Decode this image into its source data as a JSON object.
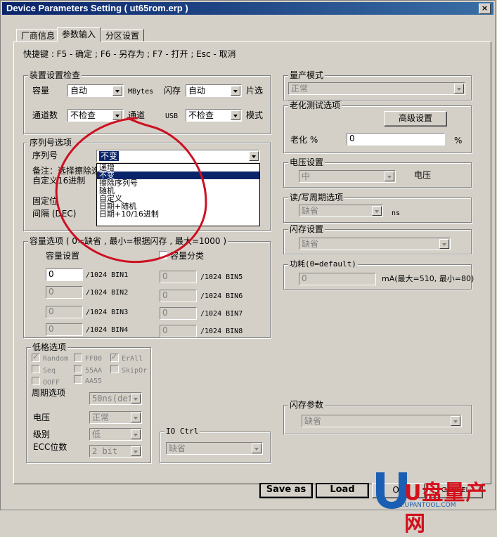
{
  "window": {
    "title": "Device Parameters Setting ( ut65rom.erp )",
    "close": "×"
  },
  "tabs": [
    "厂商信息",
    "参数输入",
    "分区设置"
  ],
  "shortcuts": "快捷键 : F5 - 确定 ; F6 - 另存为 ; F7 - 打开 ; Esc - 取消",
  "device_check": {
    "title": "装置设置检查",
    "capacity_label": "容量",
    "capacity_value": "自动",
    "capacity_unit": "MBytes",
    "flash_label": "闪存",
    "flash_value": "自动",
    "flash_unit": "片选",
    "channels_label": "通道数",
    "channels_value": "不检查",
    "channels_unit": "通道",
    "usb_label": "USB",
    "usb_value": "不检查",
    "usb_unit": "模式"
  },
  "serial": {
    "title": "序列号选项",
    "serial_label": "序列号",
    "serial_value": "不变",
    "note_label": "备注：选择擦除选",
    "custom_label": "自定义16进制",
    "fixed_label": "固定位",
    "interval_label": "间隔 (DEC)",
    "dropdown_items": [
      "递增",
      "不变",
      "擦除序列号",
      "随机",
      "自定义",
      "日期+随机",
      "日期+10/16进制"
    ],
    "dropdown_selected": 1
  },
  "capacity": {
    "title": "容量选项 ( 0=缺省 , 最小=根据闪存 , 最大=1000 )",
    "setting_label": "容量设置",
    "classify_label": "容量分类",
    "unit": "/1024",
    "bins_left": [
      {
        "value": "0",
        "name": "BIN1"
      },
      {
        "value": "0",
        "name": "BIN2"
      },
      {
        "value": "0",
        "name": "BIN3"
      },
      {
        "value": "0",
        "name": "BIN4"
      }
    ],
    "bins_right": [
      {
        "value": "0",
        "name": "BIN5"
      },
      {
        "value": "0",
        "name": "BIN6"
      },
      {
        "value": "0",
        "name": "BIN7"
      },
      {
        "value": "0",
        "name": "BIN8"
      }
    ]
  },
  "lowformat": {
    "title": "低格选项",
    "random": "Random",
    "ff00": "FF00",
    "erall": "ErAll",
    "seq": "Seq",
    "55aa": "55AA",
    "skip": "SkipOr",
    "ooff": "OOFF",
    "aa55": "AA55",
    "cycle_label": "周期选项",
    "cycle_value": "50ns(defa",
    "voltage_label": "电压",
    "voltage_value": "正常",
    "level_label": "级别",
    "level_value": "低",
    "ecc_label": "ECC位数",
    "ecc_value": "2 bit"
  },
  "io": {
    "title": "IO Ctrl",
    "value": "缺省"
  },
  "mass": {
    "title": "量产模式",
    "value": "正常"
  },
  "aging": {
    "title": "老化测试选项",
    "advanced": "高级设置",
    "label": "老化 %",
    "value": "0",
    "unit": "%"
  },
  "voltage": {
    "title": "电压设置",
    "value": "中",
    "unit": "电压"
  },
  "rw": {
    "title": "读/写周期选项",
    "value": "缺省",
    "unit": "ns"
  },
  "flash_set": {
    "title": "闪存设置",
    "value": "缺省"
  },
  "power": {
    "title": "功耗(0=default)",
    "value": "0",
    "unit": "mA(最大=510, 最小=80)"
  },
  "flash_param": {
    "title": "闪存参数",
    "value": "缺省"
  },
  "buttons": {
    "save_as": "Save as",
    "load": "Load",
    "ok": "OK",
    "cancel": "CANCEL"
  },
  "watermark": {
    "brand": "U盘量产网",
    "url": "WWW.UPANTOOL.COM"
  },
  "colors": {
    "titlebar": "#0a246a",
    "face": "#d4d0c8",
    "annotation": "#cc1122",
    "logo_blue": "#1a5fb4",
    "logo_red": "#d4101c"
  }
}
